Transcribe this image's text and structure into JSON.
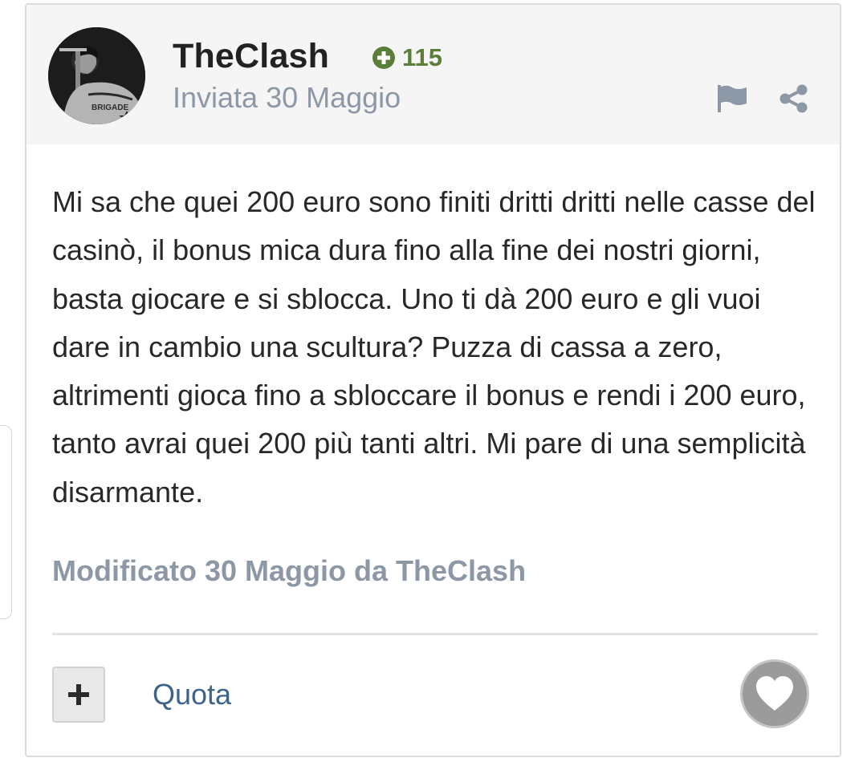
{
  "post": {
    "author": "TheClash",
    "reputation": "115",
    "date": "Inviata 30 Maggio",
    "body": "Mi sa che quei 200 euro sono finiti dritti dritti nelle casse del casinò, il bonus mica dura fino alla fine dei nostri giorni, basta giocare e si sblocca. Uno ti dà 200 euro e gli vuoi dare in cambio una scultura? Puzza di cassa a zero, altrimenti gioca fino a sbloccare il bonus e rendi i 200 euro, tanto avrai quei 200 più tanti altri. Mi pare di una semplicità disarmante.",
    "edit_note": "Modificato 30 Maggio da TheClash",
    "avatar_text": "BRIGADE"
  },
  "actions": {
    "quote_label": "Quota",
    "report_icon": "flag-icon",
    "share_icon": "share-icon",
    "like_icon": "heart-icon",
    "multiquote_icon": "plus-icon"
  },
  "colors": {
    "reputation": "#5b7e3a",
    "muted": "#8d98a6",
    "link": "#3e6589",
    "header_bg": "#f5f5f5",
    "like_bg": "#9b9b9b"
  }
}
